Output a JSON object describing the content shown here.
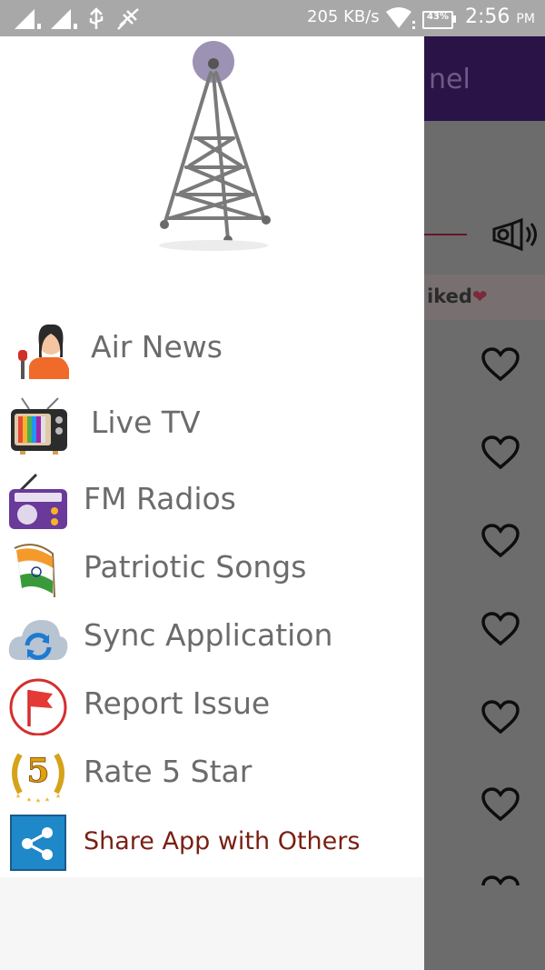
{
  "status_bar": {
    "speed": "205 KB/s",
    "battery": "43%",
    "time": "2:56",
    "ampm": "PM"
  },
  "background": {
    "toolbar_title": "nel",
    "liked_label": "iked",
    "liked_heart": "❤"
  },
  "drawer": {
    "logo_icon": "radio-tower-icon",
    "items": [
      {
        "label": "Air News",
        "icon": "news-reporter-icon"
      },
      {
        "label": "Live TV",
        "icon": "television-icon"
      },
      {
        "label": "FM Radios",
        "icon": "radio-icon"
      },
      {
        "label": "Patriotic Songs",
        "icon": "india-flag-icon"
      },
      {
        "label": "Sync Application",
        "icon": "cloud-sync-icon"
      },
      {
        "label": "Report Issue",
        "icon": "report-flag-icon"
      },
      {
        "label": "Rate 5 Star",
        "icon": "five-star-badge-icon"
      },
      {
        "label": "Share App with Others",
        "icon": "share-icon"
      }
    ]
  },
  "colors": {
    "toolbar": "#2a1447",
    "menu_text": "#6b6b6b",
    "share_text": "#7a1f12",
    "status_bar": "#a8a8a8"
  }
}
